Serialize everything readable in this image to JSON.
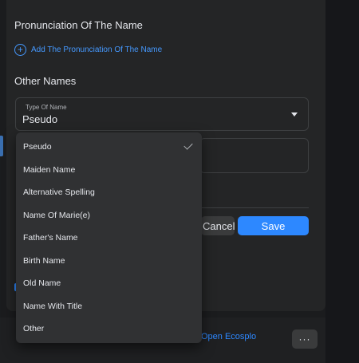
{
  "pronunciation": {
    "title": "Pronunciation Of The Name",
    "add_label": "Add The Pronunciation Of The Name",
    "add_icon": "plus-circle-icon"
  },
  "other_names": {
    "title": "Other Names",
    "type_label": "Type Of Name",
    "selected_value": "Pseudo"
  },
  "dropdown": {
    "options": [
      "Pseudo",
      "Maiden Name",
      "Alternative Spelling",
      "Name Of Marie(e)",
      "Father's Name",
      "Birth Name",
      "Old Name",
      "Name With Title",
      "Other"
    ],
    "selected_index": 0
  },
  "buttons": {
    "cancel": "Cancel",
    "save": "Save"
  },
  "footer": {
    "link": "Open Ecosplo",
    "more": "···"
  },
  "colors": {
    "accent": "#2d88ff",
    "panel": "#242526",
    "dropdown": "#303133"
  }
}
